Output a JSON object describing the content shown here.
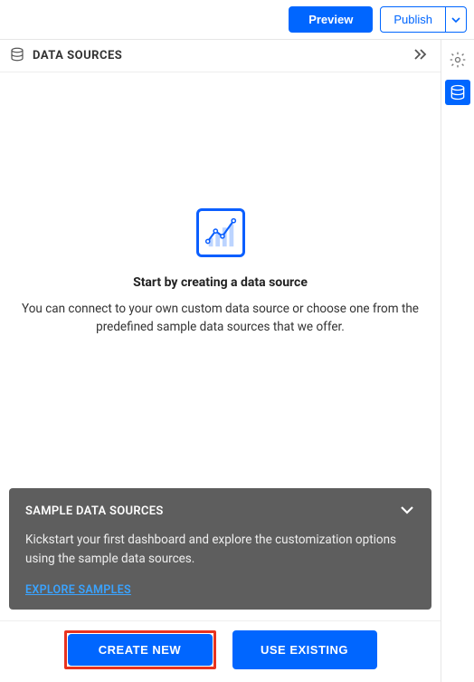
{
  "topbar": {
    "preview_label": "Preview",
    "publish_label": "Publish"
  },
  "panel": {
    "title": "DATA SOURCES"
  },
  "empty_state": {
    "title": "Start by creating a data source",
    "description": "You can connect to your own custom data source or choose one from the predefined sample data sources that we offer."
  },
  "sample_card": {
    "title": "SAMPLE DATA SOURCES",
    "description": "Kickstart your first dashboard and explore the customization options using the sample data sources.",
    "link_label": "EXPLORE SAMPLES"
  },
  "actions": {
    "create_new_label": "CREATE NEW",
    "use_existing_label": "USE EXISTING"
  }
}
